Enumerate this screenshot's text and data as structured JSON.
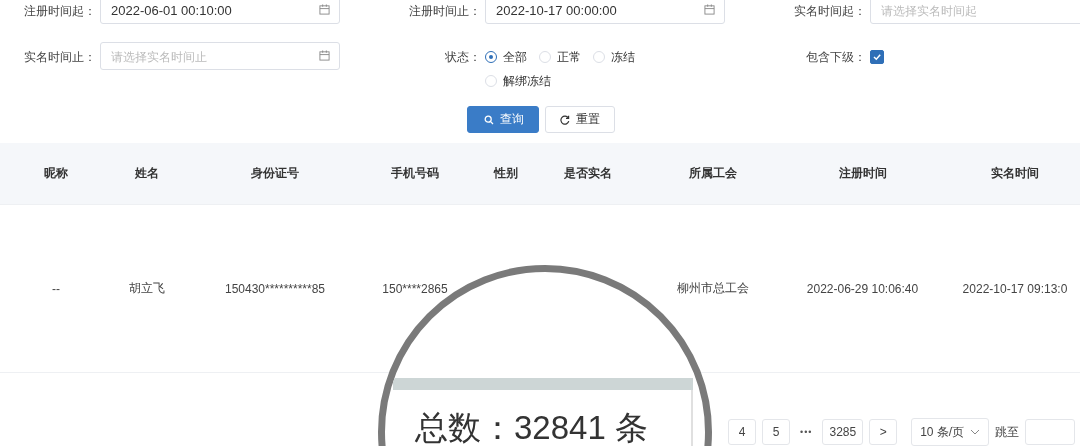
{
  "filters": [
    {
      "label": "注册时间起：",
      "value": "2022-06-01 00:10:00"
    },
    {
      "label": "注册时间止：",
      "value": "2022-10-17 00:00:00"
    },
    {
      "label": "实名时间起：",
      "placeholder": "请选择实名时间起"
    },
    {
      "label": "实名时间止：",
      "placeholder": "请选择实名时间止"
    }
  ],
  "status": {
    "label": "状态：",
    "options": [
      {
        "label": "全部",
        "selected": true
      },
      {
        "label": "正常",
        "selected": false
      },
      {
        "label": "冻结",
        "selected": false
      },
      {
        "label": "解绑冻结",
        "selected": false
      }
    ]
  },
  "include_sub": {
    "label": "包含下级：",
    "checked": true
  },
  "buttons": [
    {
      "kind": "primary",
      "label": "查询"
    },
    {
      "kind": "default",
      "label": "重置"
    }
  ],
  "table": {
    "columns": [
      "昵称",
      "姓名",
      "身份证号",
      "手机号码",
      "性别",
      "是否实名",
      "所属工会",
      "注册时间",
      "实名时间"
    ],
    "rows": [
      {
        "cells": [
          "--",
          "胡立飞",
          "150430**********85",
          "150****2865",
          null,
          null,
          "柳州市总工会",
          "2022-06-29 10:06:40",
          "2022-10-17 09:13:0"
        ]
      }
    ]
  },
  "pagination": {
    "pages": [
      {
        "label": "4",
        "selected": false
      },
      {
        "label": "5",
        "selected": false
      }
    ],
    "ellipsis": "•••",
    "last": "3285",
    "next": ">",
    "page_size": "10 条/页",
    "jump_label": "跳至"
  },
  "magnifier": {
    "total": "总数：32841 条"
  }
}
